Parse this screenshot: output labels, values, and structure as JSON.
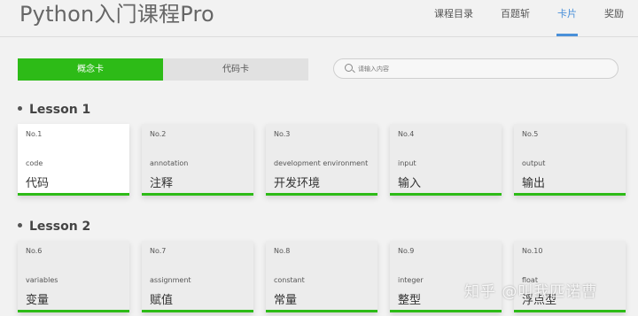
{
  "header": {
    "title": "Python入门课程Pro",
    "nav": [
      {
        "label": "课程目录",
        "active": false
      },
      {
        "label": "百题斩",
        "active": false
      },
      {
        "label": "卡片",
        "active": true
      },
      {
        "label": "奖励",
        "active": false
      }
    ]
  },
  "toggle": {
    "concept_label": "概念卡",
    "code_label": "代码卡",
    "active": "concept"
  },
  "search": {
    "placeholder": "请输入内容",
    "value": ""
  },
  "lessons": [
    {
      "title": "Lesson 1",
      "cards": [
        {
          "no": "No.1",
          "en": "code",
          "zh": "代码",
          "selected": true
        },
        {
          "no": "No.2",
          "en": "annotation",
          "zh": "注释",
          "selected": false
        },
        {
          "no": "No.3",
          "en": "development environment",
          "zh": "开发环境",
          "selected": false
        },
        {
          "no": "No.4",
          "en": "input",
          "zh": "输入",
          "selected": false
        },
        {
          "no": "No.5",
          "en": "output",
          "zh": "输出",
          "selected": false
        }
      ]
    },
    {
      "title": "Lesson 2",
      "cards": [
        {
          "no": "No.6",
          "en": "variables",
          "zh": "变量",
          "selected": false
        },
        {
          "no": "No.7",
          "en": "assignment",
          "zh": "赋值",
          "selected": false
        },
        {
          "no": "No.8",
          "en": "constant",
          "zh": "常量",
          "selected": false
        },
        {
          "no": "No.9",
          "en": "integer",
          "zh": "整型",
          "selected": false
        },
        {
          "no": "No.10",
          "en": "float",
          "zh": "浮点型",
          "selected": false
        }
      ]
    }
  ],
  "watermark": "知乎 @叫我匹诺曹",
  "colors": {
    "accent_green": "#2dbb17",
    "nav_active_blue": "#4a90d9"
  }
}
